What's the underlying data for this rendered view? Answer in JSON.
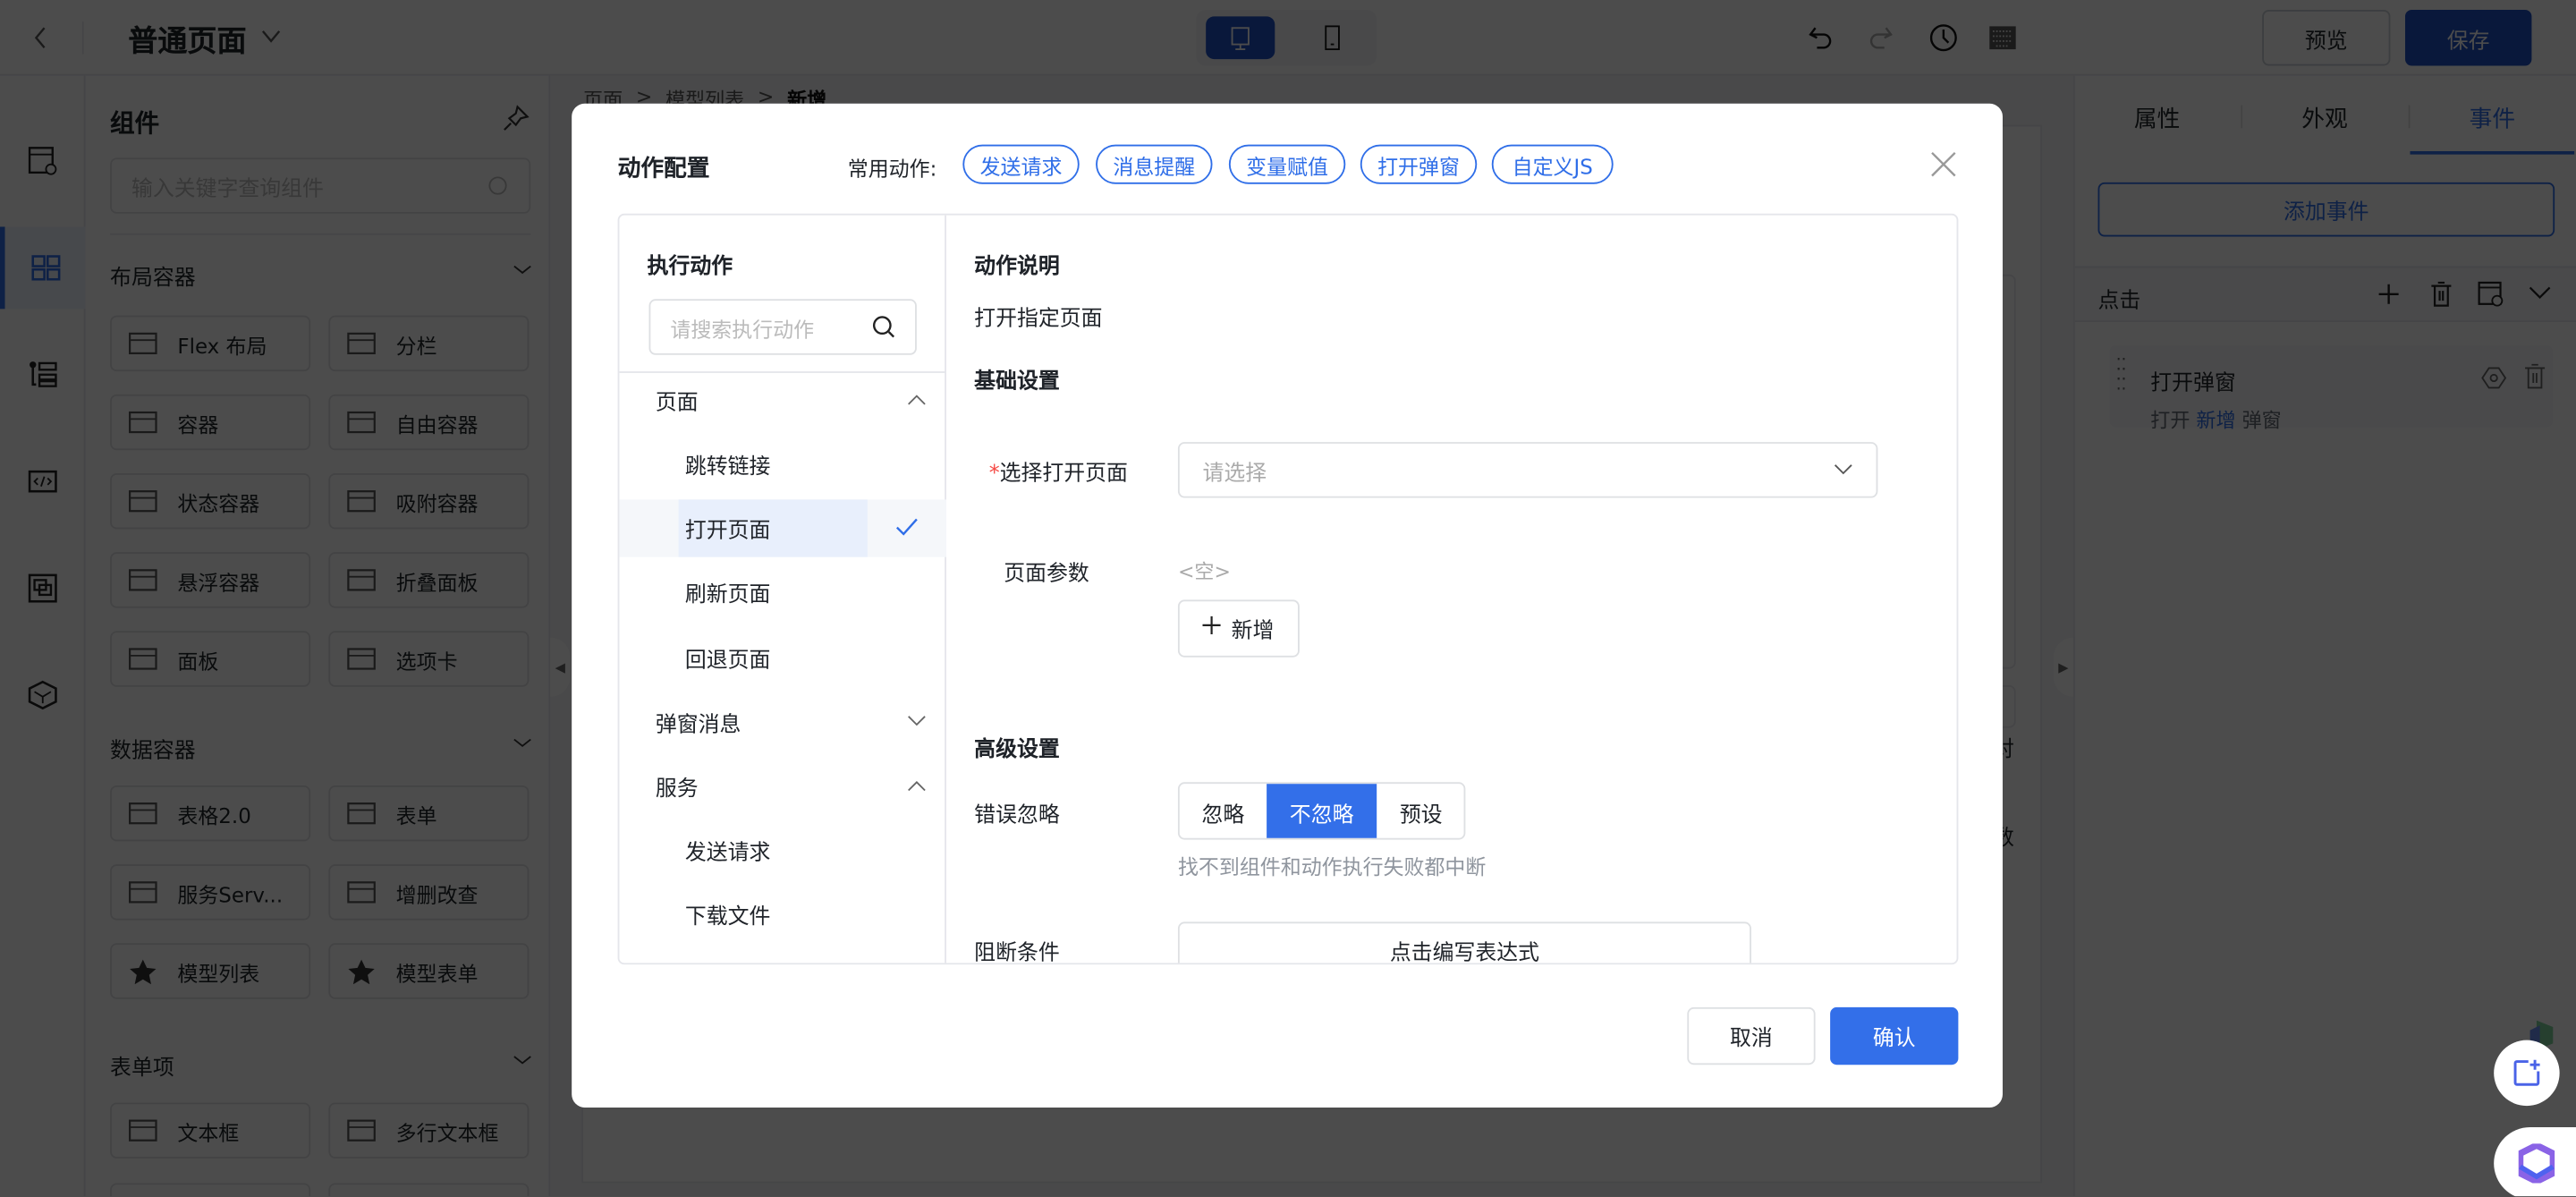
{
  "header": {
    "title": "普通页面",
    "preview_label": "预览",
    "save_label": "保存",
    "device_modes": [
      "desktop",
      "mobile"
    ],
    "active_device": "desktop"
  },
  "leftbar": {
    "icons": [
      "page-settings-icon",
      "components-icon",
      "outline-tree-icon",
      "code-icon",
      "layers-icon",
      "package-icon"
    ],
    "active": 1
  },
  "components": {
    "title": "组件",
    "search_placeholder": "输入关键字查询组件",
    "sections": [
      {
        "title": "布局容器",
        "items": [
          {
            "label": "Flex 布局",
            "icon": "flex-layout-icon"
          },
          {
            "label": "分栏",
            "icon": "columns-icon"
          },
          {
            "label": "容器",
            "icon": "container-icon"
          },
          {
            "label": "自由容器",
            "icon": "free-container-icon"
          },
          {
            "label": "状态容器",
            "icon": "state-container-icon"
          },
          {
            "label": "吸附容器",
            "icon": "sticky-container-icon"
          },
          {
            "label": "悬浮容器",
            "icon": "float-container-icon"
          },
          {
            "label": "折叠面板",
            "icon": "collapse-icon"
          },
          {
            "label": "面板",
            "icon": "panel-icon"
          },
          {
            "label": "选项卡",
            "icon": "tabs-icon"
          }
        ]
      },
      {
        "title": "数据容器",
        "items": [
          {
            "label": "表格2.0",
            "icon": "table-icon"
          },
          {
            "label": "表单",
            "icon": "form-icon"
          },
          {
            "label": "服务Serv...",
            "icon": "service-icon"
          },
          {
            "label": "增删改查",
            "icon": "crud-icon"
          },
          {
            "label": "模型列表",
            "icon": "star-icon"
          },
          {
            "label": "模型表单",
            "icon": "star-icon"
          }
        ]
      },
      {
        "title": "表单项",
        "items": [
          {
            "label": "文本框",
            "icon": "text-input-icon"
          },
          {
            "label": "多行文本框",
            "icon": "textarea-icon"
          }
        ]
      }
    ]
  },
  "canvas": {
    "breadcrumb": [
      "页面",
      "模型列表",
      "新增"
    ],
    "partial_texts": [
      "对",
      "数"
    ]
  },
  "right_panel": {
    "tabs": [
      "属性",
      "外观",
      "事件"
    ],
    "active_tab": 2,
    "add_event_label": "添加事件",
    "event_name": "点击",
    "action_card": {
      "title": "打开弹窗",
      "desc_prefix": "打开",
      "desc_link": "新增",
      "desc_suffix": "弹窗"
    }
  },
  "modal": {
    "title": "动作配置",
    "common_actions_label": "常用动作:",
    "common_actions": [
      "发送请求",
      "消息提醒",
      "变量赋值",
      "打开弹窗",
      "自定义JS"
    ],
    "left": {
      "title": "执行动作",
      "search_placeholder": "请搜索执行动作",
      "groups": [
        {
          "label": "页面",
          "expanded": true,
          "items": [
            "跳转链接",
            "打开页面",
            "刷新页面",
            "回退页面"
          ]
        },
        {
          "label": "弹窗消息",
          "expanded": false,
          "items": []
        },
        {
          "label": "服务",
          "expanded": true,
          "items": [
            "发送请求",
            "下载文件"
          ]
        }
      ],
      "selected": "打开页面"
    },
    "right": {
      "desc_title": "动作说明",
      "desc_text": "打开指定页面",
      "basic_title": "基础设置",
      "page_label": "选择打开页面",
      "required_mark": "*",
      "page_placeholder": "请选择",
      "params_label": "页面参数",
      "params_empty": "<空>",
      "add_label": "新增",
      "advanced_title": "高级设置",
      "ignore_label": "错误忽略",
      "ignore_options": [
        "忽略",
        "不忽略",
        "预设"
      ],
      "ignore_selected": "不忽略",
      "ignore_help": "找不到组件和动作执行失败都中断",
      "block_label": "阻断条件",
      "block_button": "点击编写表达式"
    },
    "cancel_label": "取消",
    "confirm_label": "确认"
  },
  "colors": {
    "primary": "#2f6ee8",
    "selected_bg": "#e8effc",
    "mask": "rgba(0,0,0,0.7)"
  }
}
